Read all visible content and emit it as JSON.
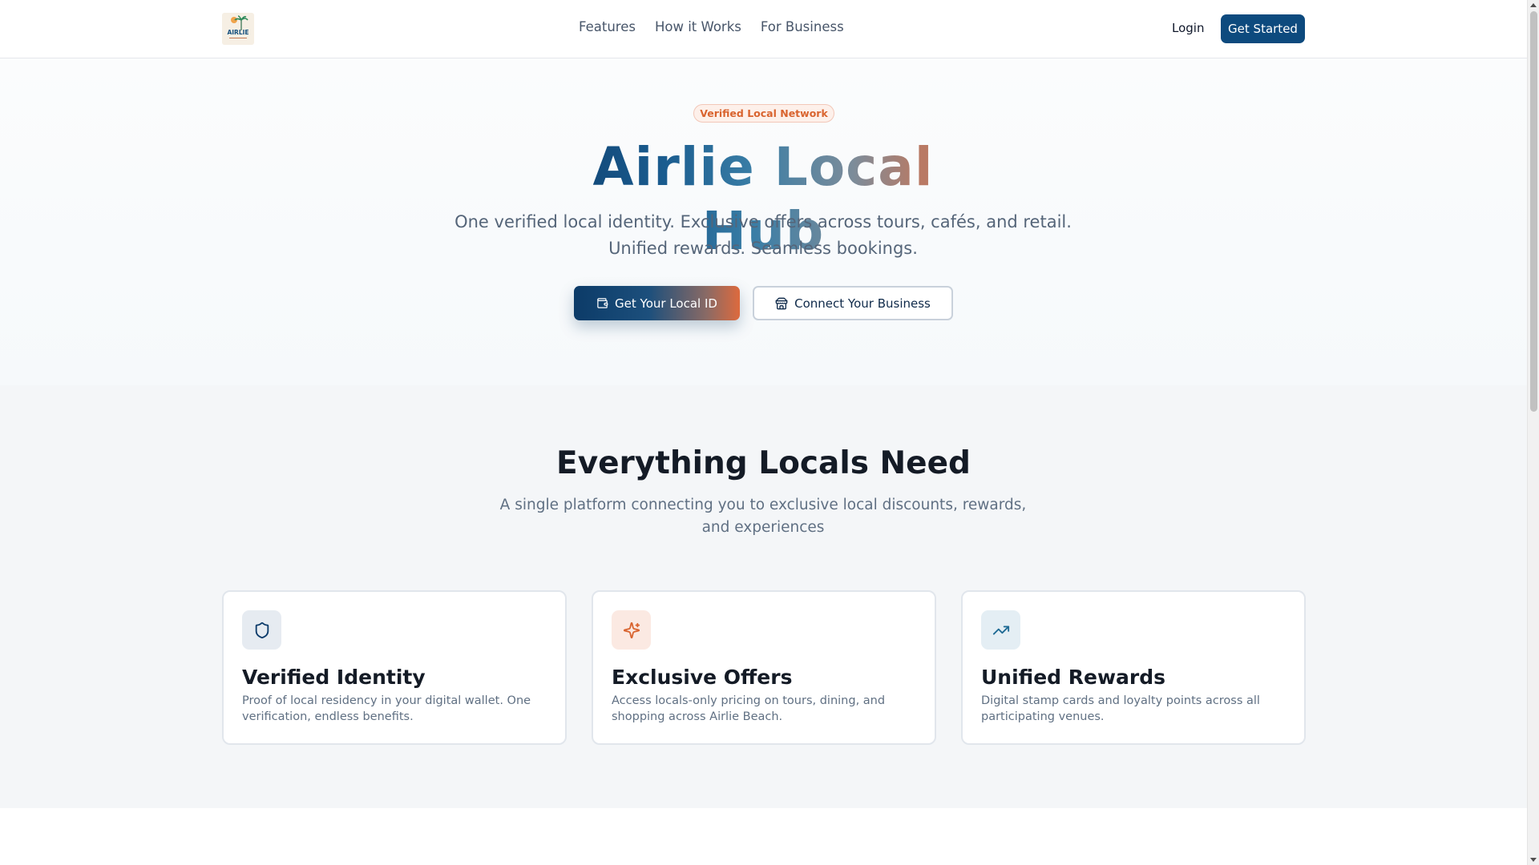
{
  "header": {
    "logo_text": "AIRLIE",
    "nav": [
      {
        "label": "Features"
      },
      {
        "label": "How it Works"
      },
      {
        "label": "For Business"
      }
    ],
    "login_label": "Login",
    "cta_label": "Get Started"
  },
  "hero": {
    "badge": "Verified Local Network",
    "title": "Airlie Local Hub",
    "subtitle_line1": "One verified local identity. Exclusive offers across tours, cafés, and retail.",
    "subtitle_line2": "Unified rewards. Seamless bookings.",
    "primary_button": "Get Your Local ID",
    "secondary_button": "Connect Your Business"
  },
  "features": {
    "title": "Everything Locals Need",
    "subtitle_line1": "A single platform connecting you to exclusive local discounts, rewards,",
    "subtitle_line2": "and experiences",
    "cards": [
      {
        "icon": "shield-icon",
        "title": "Verified Identity",
        "description": "Proof of local residency in your digital wallet. One verification, endless benefits."
      },
      {
        "icon": "sparkles-icon",
        "title": "Exclusive Offers",
        "description": "Access locals-only pricing on tours, dining, and shopping across Airlie Beach."
      },
      {
        "icon": "trending-up-icon",
        "title": "Unified Rewards",
        "description": "Digital stamp cards and loyalty points across all participating venues."
      }
    ]
  },
  "colors": {
    "brand_navy": "#0d4a7e",
    "accent_orange": "#dd6a3e",
    "badge_text": "#d9642f"
  }
}
